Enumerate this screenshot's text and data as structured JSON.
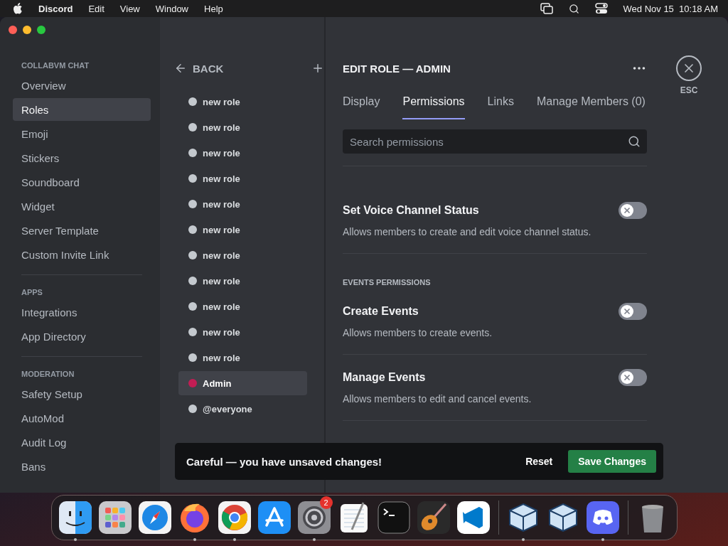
{
  "menubar": {
    "app": "Discord",
    "menus": [
      "Edit",
      "View",
      "Window",
      "Help"
    ],
    "clock": "Wed Nov 15  10:18 AM"
  },
  "sidebar": {
    "sections": [
      {
        "header": "COLLABVM CHAT",
        "items": [
          {
            "label": "Overview",
            "selected": false
          },
          {
            "label": "Roles",
            "selected": true
          },
          {
            "label": "Emoji",
            "selected": false
          },
          {
            "label": "Stickers",
            "selected": false
          },
          {
            "label": "Soundboard",
            "selected": false
          },
          {
            "label": "Widget",
            "selected": false
          },
          {
            "label": "Server Template",
            "selected": false
          },
          {
            "label": "Custom Invite Link",
            "selected": false
          }
        ]
      },
      {
        "header": "APPS",
        "items": [
          {
            "label": "Integrations",
            "selected": false
          },
          {
            "label": "App Directory",
            "selected": false
          }
        ]
      },
      {
        "header": "MODERATION",
        "items": [
          {
            "label": "Safety Setup",
            "selected": false
          },
          {
            "label": "AutoMod",
            "selected": false
          },
          {
            "label": "Audit Log",
            "selected": false
          },
          {
            "label": "Bans",
            "selected": false
          }
        ]
      }
    ]
  },
  "roles": {
    "back": "BACK",
    "items": [
      {
        "name": "new role",
        "color": "#c4c9ce",
        "selected": false
      },
      {
        "name": "new role",
        "color": "#c4c9ce",
        "selected": false
      },
      {
        "name": "new role",
        "color": "#c4c9ce",
        "selected": false
      },
      {
        "name": "new role",
        "color": "#c4c9ce",
        "selected": false
      },
      {
        "name": "new role",
        "color": "#c4c9ce",
        "selected": false
      },
      {
        "name": "new role",
        "color": "#c4c9ce",
        "selected": false
      },
      {
        "name": "new role",
        "color": "#c4c9ce",
        "selected": false
      },
      {
        "name": "new role",
        "color": "#c4c9ce",
        "selected": false
      },
      {
        "name": "new role",
        "color": "#c4c9ce",
        "selected": false
      },
      {
        "name": "new role",
        "color": "#c4c9ce",
        "selected": false
      },
      {
        "name": "new role",
        "color": "#c4c9ce",
        "selected": false
      },
      {
        "name": "Admin",
        "color": "#c21d54",
        "selected": true
      },
      {
        "name": "@everyone",
        "color": "#c4c9ce",
        "selected": false
      }
    ]
  },
  "main": {
    "title": "EDIT ROLE — ADMIN",
    "tabs": [
      {
        "label": "Display",
        "selected": false
      },
      {
        "label": "Permissions",
        "selected": true
      },
      {
        "label": "Links",
        "selected": false
      },
      {
        "label": "Manage Members (0)",
        "selected": false
      }
    ],
    "search": {
      "placeholder": "Search permissions"
    },
    "permissions": [
      {
        "kind": "permission",
        "title": "Set Voice Channel Status",
        "description": "Allows members to create and edit voice channel status.",
        "on": false
      },
      {
        "kind": "header",
        "title": "EVENTS PERMISSIONS"
      },
      {
        "kind": "permission",
        "title": "Create Events",
        "description": "Allows members to create events.",
        "on": false
      },
      {
        "kind": "permission",
        "title": "Manage Events",
        "description": "Allows members to edit and cancel events.",
        "on": false
      }
    ],
    "esc": "ESC"
  },
  "toast": {
    "message": "Careful — you have unsaved changes!",
    "reset": "Reset",
    "save": "Save Changes"
  },
  "dock": [
    {
      "kind": "finder",
      "running": true
    },
    {
      "kind": "launchpad",
      "running": false
    },
    {
      "kind": "safari",
      "running": false
    },
    {
      "kind": "firefox",
      "running": true
    },
    {
      "kind": "chrome",
      "running": true
    },
    {
      "kind": "appstore",
      "running": false
    },
    {
      "kind": "settings",
      "running": true,
      "badge": "2"
    },
    {
      "kind": "textedit",
      "running": false
    },
    {
      "kind": "terminal",
      "running": false
    },
    {
      "kind": "guitar",
      "running": false
    },
    {
      "kind": "vscode",
      "running": false
    },
    {
      "kind": "divider"
    },
    {
      "kind": "virtualbox",
      "running": true
    },
    {
      "kind": "virtualbox",
      "running": false
    },
    {
      "kind": "discord",
      "running": true
    },
    {
      "kind": "divider"
    },
    {
      "kind": "trash",
      "running": false
    }
  ]
}
